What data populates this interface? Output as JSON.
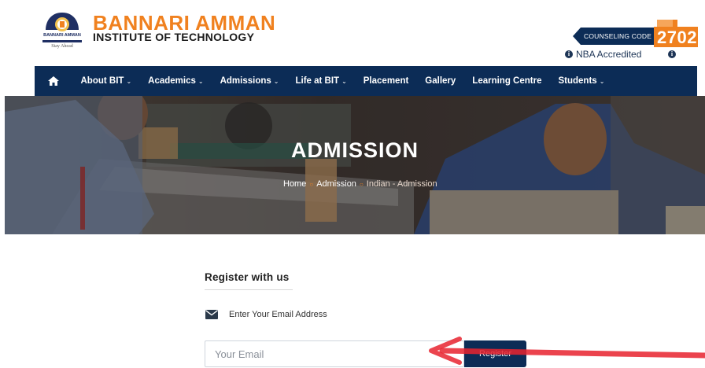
{
  "header": {
    "logo_line1": "BANNARI AMMAN",
    "logo_tagline": "Stay Ahead",
    "brand_line1": "BANNARI AMMAN",
    "brand_line2": "INSTITUTE OF TECHNOLOGY",
    "counseling_label": "COUNSELING CODE",
    "counseling_code": "2702",
    "nba_label": "NBA Accredited"
  },
  "nav": {
    "home_icon": "home-icon",
    "items": [
      {
        "label": "About BIT",
        "dropdown": true
      },
      {
        "label": "Academics",
        "dropdown": true
      },
      {
        "label": "Admissions",
        "dropdown": true
      },
      {
        "label": "Life at BIT",
        "dropdown": true
      },
      {
        "label": "Placement",
        "dropdown": false
      },
      {
        "label": "Gallery",
        "dropdown": false
      },
      {
        "label": "Learning Centre",
        "dropdown": false
      },
      {
        "label": "Students",
        "dropdown": true
      }
    ]
  },
  "banner": {
    "title": "ADMISSION",
    "breadcrumb": [
      "Home",
      "Admission",
      "Indian - Admission"
    ]
  },
  "register": {
    "title": "Register with us",
    "email_label": "Enter Your Email Address",
    "email_placeholder": "Your Email",
    "email_value": "",
    "button_label": "Register"
  },
  "colors": {
    "brand_orange": "#f0811f",
    "nav_blue": "#0c2c56",
    "arrow_red": "#e8232f"
  }
}
